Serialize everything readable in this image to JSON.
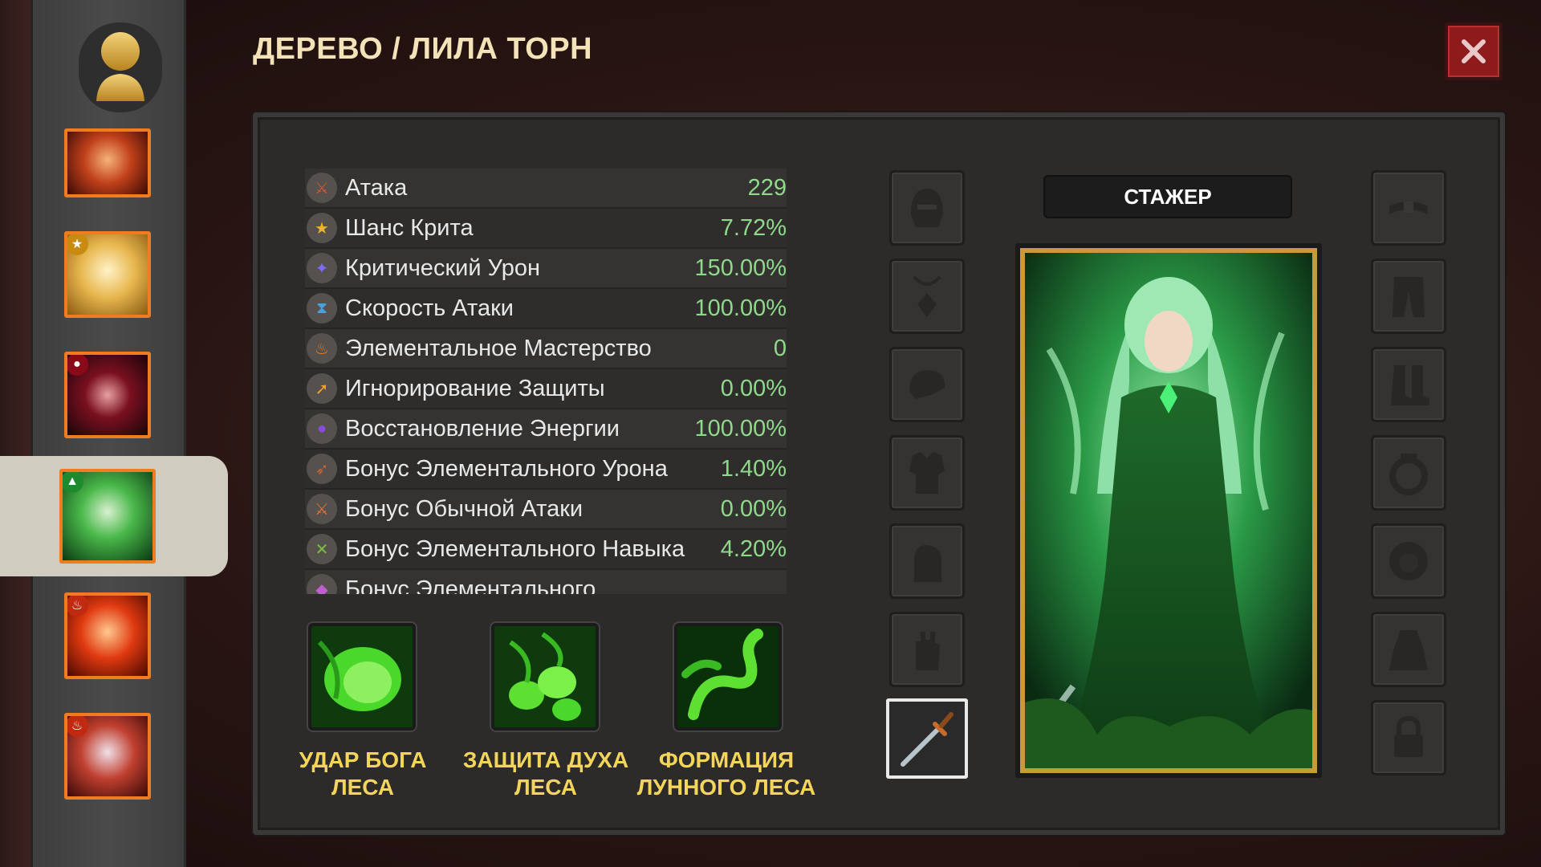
{
  "header": {
    "title": "ДЕРЕВО / ЛИЛА ТОРН"
  },
  "stats": [
    {
      "icon": "sword-icon",
      "label": "Атака",
      "value": "229",
      "color": "#d9533a"
    },
    {
      "icon": "star-icon",
      "label": "Шанс Крита",
      "value": "7.72%",
      "color": "#f0b429"
    },
    {
      "icon": "crystal-icon",
      "label": "Критический Урон",
      "value": "150.00%",
      "color": "#7a6cff"
    },
    {
      "icon": "hourglass-icon",
      "label": "Скорость Атаки",
      "value": "100.00%",
      "color": "#4aa0d8"
    },
    {
      "icon": "flame-icon",
      "label": "Элементальное Мастерство",
      "value": "0",
      "color": "#f07a1a"
    },
    {
      "icon": "arrow-icon",
      "label": "Игнорирование Защиты",
      "value": "0.00%",
      "color": "#f0a030"
    },
    {
      "icon": "orb-icon",
      "label": "Восстановление Энергии",
      "value": "100.00%",
      "color": "#8a4ae0"
    },
    {
      "icon": "bow-icon",
      "label": "Бонус Элементального Урона",
      "value": "1.40%",
      "color": "#c8643a"
    },
    {
      "icon": "blade-icon",
      "label": "Бонус Обычной Атаки",
      "value": "0.00%",
      "color": "#e8703a"
    },
    {
      "icon": "crossbow-icon",
      "label": "Бонус Элементального Навыка",
      "value": "4.20%",
      "color": "#7ac040"
    },
    {
      "icon": "gem-icon",
      "label": "Бонус Элементального",
      "value": "",
      "color": "#c060d0"
    }
  ],
  "skills": [
    {
      "name": "УДАР БОГА ЛЕСА"
    },
    {
      "name": "ЗАЩИТА ДУХА ЛЕСА"
    },
    {
      "name": "ФОРМАЦИЯ ЛУННОГО ЛЕСА"
    }
  ],
  "hero": {
    "rank": "СТАЖЕР"
  },
  "colors": {
    "accent": "#ef7d1f",
    "stat_value": "#8fd98a",
    "skill_label": "#f3d55a",
    "close": "#8e1b1b"
  }
}
